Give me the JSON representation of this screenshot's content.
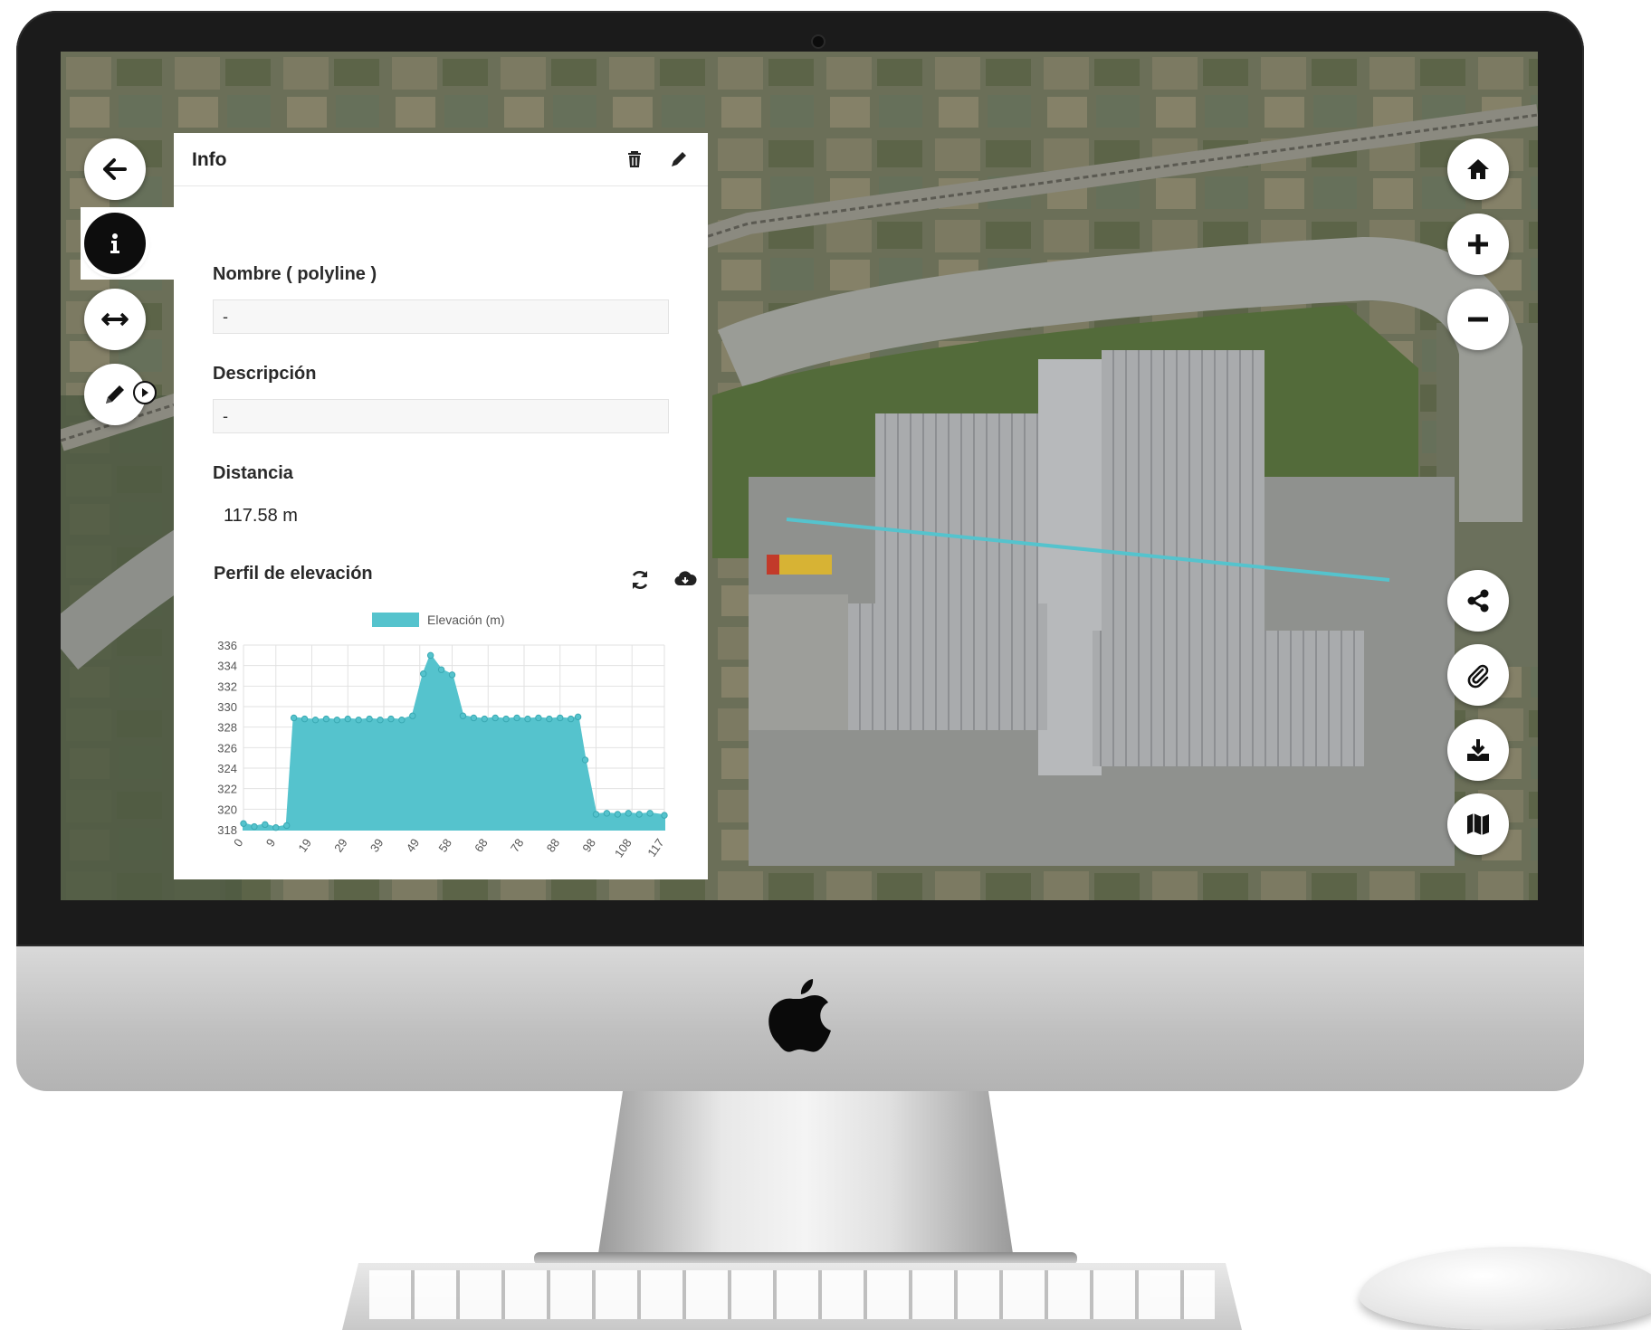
{
  "panel": {
    "title": "Info",
    "name_label": "Nombre ( polyline )",
    "name_value": "-",
    "description_label": "Descripción",
    "description_value": "-",
    "distance_label": "Distancia",
    "distance_value": "117.58 m",
    "elevation_label": "Perfil de elevación"
  },
  "colors": {
    "accent": "#55c3cd",
    "panel_bg": "#ffffff",
    "button_dark": "#0d0d0d"
  },
  "icons": {
    "left": [
      "back-arrow-icon",
      "info-icon",
      "measure-distance-icon",
      "pencil-icon"
    ],
    "right": [
      "home-icon",
      "zoom-in-icon",
      "zoom-out-icon",
      "share-icon",
      "attach-icon",
      "download-icon",
      "map-icon"
    ]
  },
  "chart_data": {
    "type": "area",
    "legend": "Elevación (m)",
    "x": [
      "0",
      "9",
      "19",
      "29",
      "39",
      "49",
      "58",
      "68",
      "78",
      "88",
      "98",
      "108",
      "117"
    ],
    "y_ticks": [
      318,
      320,
      322,
      324,
      326,
      328,
      330,
      332,
      334,
      336
    ],
    "ylim": [
      318,
      336
    ],
    "points": [
      [
        0,
        318.6
      ],
      [
        3,
        318.3
      ],
      [
        6,
        318.5
      ],
      [
        9,
        318.2
      ],
      [
        12,
        318.4
      ],
      [
        14,
        328.9
      ],
      [
        17,
        328.8
      ],
      [
        20,
        328.7
      ],
      [
        23,
        328.8
      ],
      [
        26,
        328.7
      ],
      [
        29,
        328.8
      ],
      [
        32,
        328.7
      ],
      [
        35,
        328.8
      ],
      [
        38,
        328.7
      ],
      [
        41,
        328.8
      ],
      [
        44,
        328.7
      ],
      [
        47,
        329.1
      ],
      [
        50,
        333.2
      ],
      [
        52,
        335.0
      ],
      [
        55,
        333.6
      ],
      [
        58,
        333.1
      ],
      [
        61,
        329.1
      ],
      [
        64,
        328.9
      ],
      [
        67,
        328.8
      ],
      [
        70,
        328.9
      ],
      [
        73,
        328.8
      ],
      [
        76,
        328.9
      ],
      [
        79,
        328.8
      ],
      [
        82,
        328.9
      ],
      [
        85,
        328.8
      ],
      [
        88,
        328.9
      ],
      [
        91,
        328.8
      ],
      [
        93,
        329.0
      ],
      [
        95,
        324.8
      ],
      [
        98,
        319.5
      ],
      [
        101,
        319.6
      ],
      [
        104,
        319.5
      ],
      [
        107,
        319.6
      ],
      [
        110,
        319.5
      ],
      [
        113,
        319.6
      ],
      [
        117,
        319.4
      ]
    ],
    "xlim": [
      0,
      117
    ],
    "grid": true,
    "legend_position": "top"
  }
}
